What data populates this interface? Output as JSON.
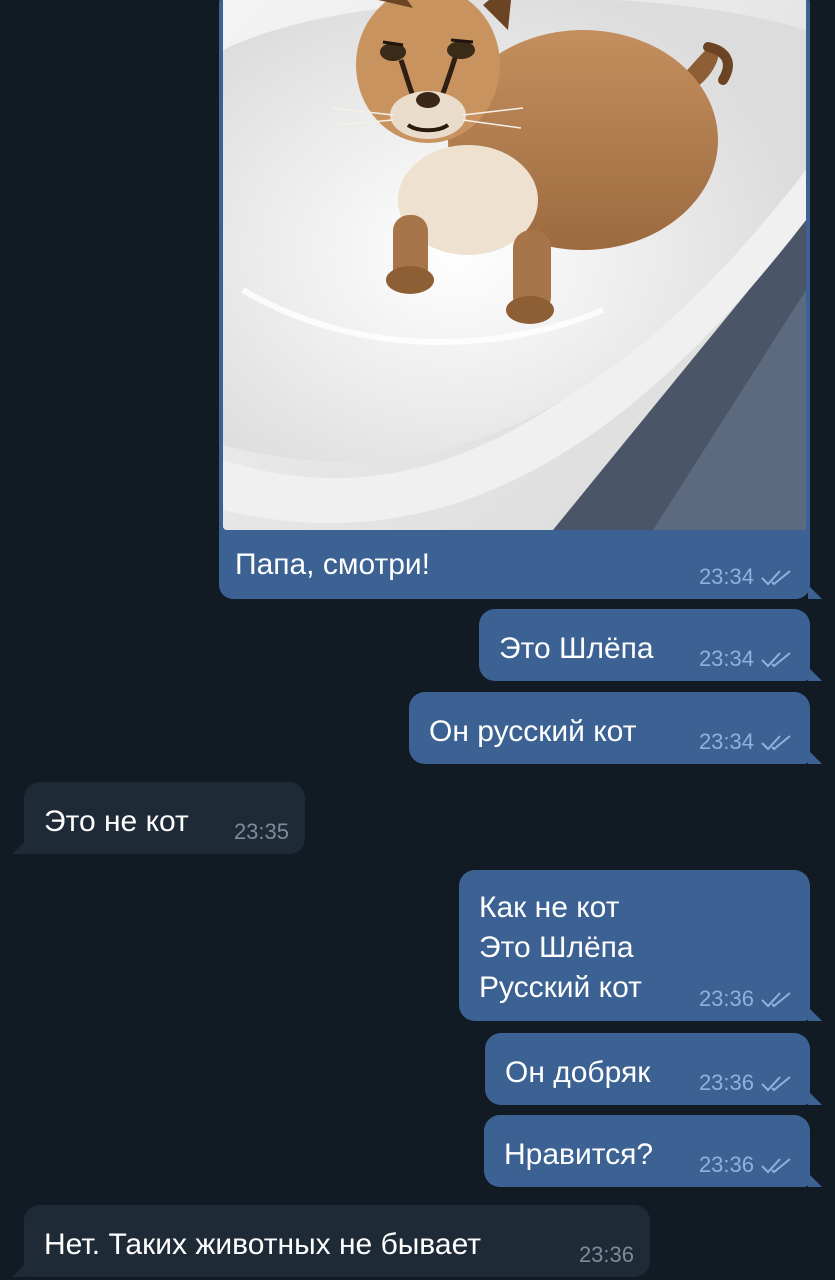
{
  "messages": [
    {
      "text": "Папа, смотри!",
      "time": "23:34",
      "outgoing": true,
      "has_photo": true,
      "photo_subject": "caracal cat sitting in a white bathtub"
    },
    {
      "text": "Это Шлёпа",
      "time": "23:34",
      "outgoing": true
    },
    {
      "text": "Он русский кот",
      "time": "23:34",
      "outgoing": true
    },
    {
      "text": "Это не кот",
      "time": "23:35",
      "outgoing": false
    },
    {
      "text": "Как не кот\nЭто Шлёпа\nРусский кот",
      "time": "23:36",
      "outgoing": true
    },
    {
      "text": "Он добряк",
      "time": "23:36",
      "outgoing": true
    },
    {
      "text": "Нравится?",
      "time": "23:36",
      "outgoing": true
    },
    {
      "text": "Нет. Таких животных не бывает",
      "time": "23:36",
      "outgoing": false
    }
  ],
  "icons": {
    "read_status": "double-check-icon"
  },
  "colors": {
    "background": "#121a24",
    "outgoing_bubble": "#3c6294",
    "incoming_bubble": "#1f2a37",
    "outgoing_time": "#8fb2dc",
    "incoming_time": "#7d8b99"
  }
}
